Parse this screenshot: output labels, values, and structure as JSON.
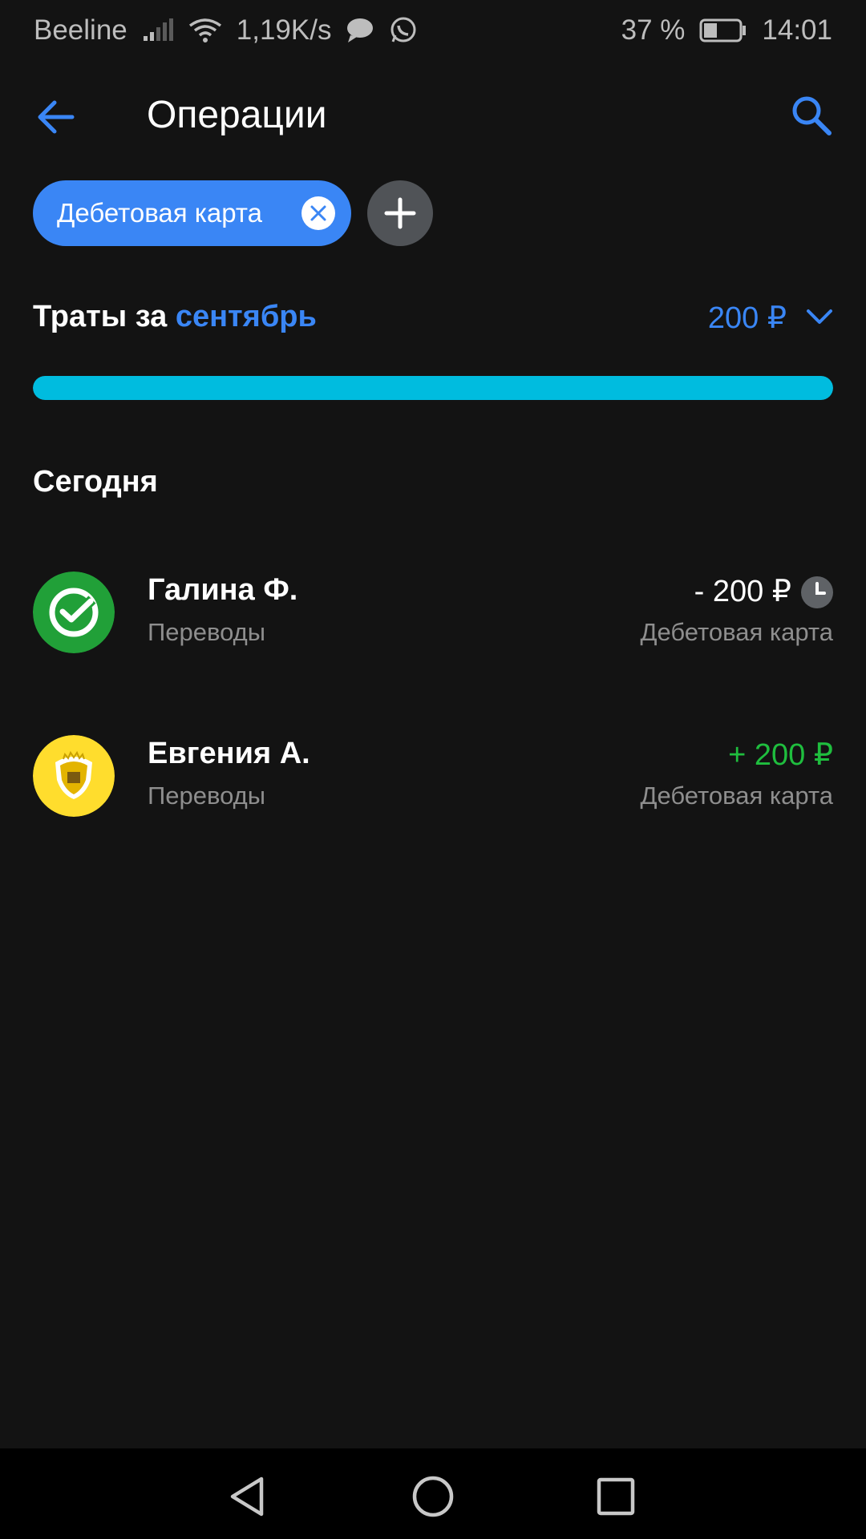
{
  "status_bar": {
    "carrier": "Beeline",
    "net_speed": "1,19K/s",
    "battery_percent": "37 %",
    "battery_level": 0.37,
    "time": "14:01"
  },
  "header": {
    "title": "Операции"
  },
  "filters": {
    "active_chip_label": "Дебетовая карта"
  },
  "spending": {
    "title_prefix": "Траты за",
    "month": "сентябрь",
    "amount": "200 ₽",
    "progress": 1.0
  },
  "sections": [
    {
      "title": "Сегодня",
      "operations": [
        {
          "name": "Галина Ф.",
          "category": "Переводы",
          "amount": "- 200 ₽",
          "account": "Дебетовая карта",
          "pending": true,
          "icon": "sber-logo-icon",
          "color": "#21a038"
        },
        {
          "name": "Евгения А.",
          "category": "Переводы",
          "amount": "+ 200 ₽",
          "account": "Дебетовая карта",
          "pending": false,
          "icon": "tinkoff-logo-icon",
          "color": "#ffdd2d"
        }
      ]
    }
  ],
  "colors": {
    "accent": "#3a86f5",
    "progress": "#00bcdf",
    "income": "#1fbe3e",
    "background": "#131313"
  }
}
